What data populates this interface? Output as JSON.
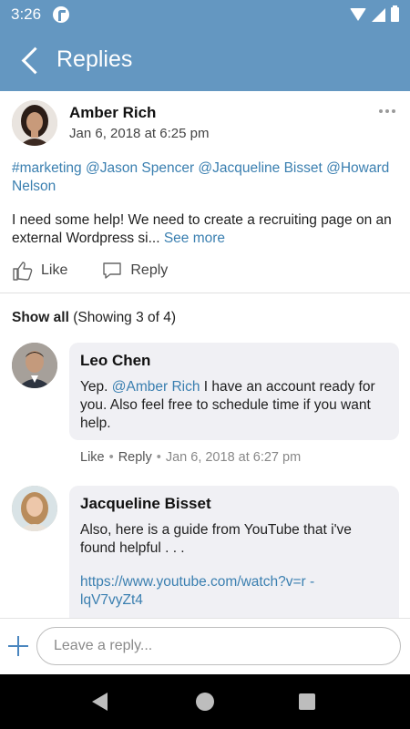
{
  "status_bar": {
    "time": "3:26"
  },
  "app_bar": {
    "title": "Replies"
  },
  "post": {
    "author": "Amber Rich",
    "date": "Jan 6, 2018 at 6:25 pm",
    "tags": "#marketing @Jason Spencer @Jacqueline Bisset @Howard Nelson",
    "text": "I need some help! We need to create a recruiting page on an external Wordpress si...",
    "see_more": "See more",
    "like_label": "Like",
    "reply_label": "Reply"
  },
  "replies_header": {
    "show_all": "Show all",
    "count_text": "(Showing 3 of 4)"
  },
  "replies": [
    {
      "author": "Leo Chen",
      "text_before": "Yep. ",
      "mention": "@Amber Rich",
      "text_after": " I have an account ready for you.  Also feel free to schedule time if you want help.",
      "like_label": "Like",
      "reply_label": "Reply",
      "timestamp": "Jan 6, 2018 at 6:27 pm"
    },
    {
      "author": "Jacqueline Bisset",
      "text": "Also, here is a guide from YouTube that i've found helpful . . .",
      "link": "https://www.youtube.com/watch?v=r -lqV7vyZt4"
    }
  ],
  "composer": {
    "placeholder": "Leave a reply..."
  },
  "icons": {
    "back": "back-arrow-icon",
    "more": "more-horizontal-icon",
    "like": "thumbs-up-icon",
    "reply": "speech-bubble-icon",
    "add": "plus-icon"
  },
  "colors": {
    "app_bar": "#6497c1",
    "link": "#3a7fb0",
    "bubble": "#f0f0f4"
  }
}
